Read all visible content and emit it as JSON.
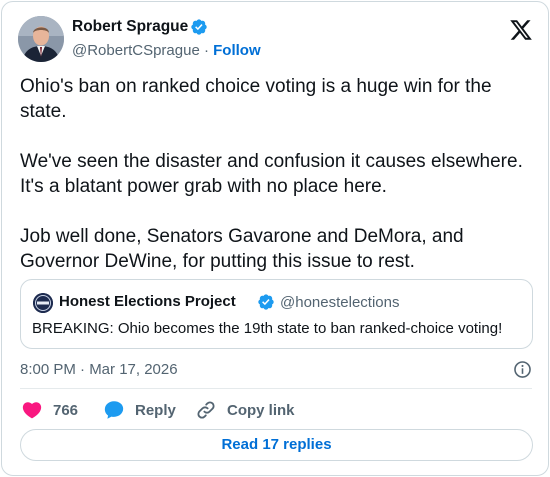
{
  "author": {
    "name": "Robert Sprague",
    "handle": "@RobertCSprague",
    "separator": " · ",
    "follow_label": "Follow"
  },
  "tweet": {
    "paragraphs": [
      "Ohio's ban on ranked choice voting is a huge win for the state.",
      "We've seen the disaster and confusion it causes elsewhere. It's a blatant power grab with no place here.",
      "Job well done, Senators Gavarone and DeMora, and Governor DeWine, for putting this issue to rest."
    ]
  },
  "quote": {
    "name": "Honest Elections Project",
    "handle": "@honestelections",
    "text": "BREAKING: Ohio becomes the 19th state to ban ranked-choice voting!"
  },
  "timestamp": "8:00 PM · Mar 17, 2026",
  "actions": {
    "like_count": "766",
    "reply_label": "Reply",
    "copy_label": "Copy link"
  },
  "read_replies_label": "Read 17 replies",
  "icons": {
    "verified": "verified-badge-icon",
    "x_logo": "x-logo-icon",
    "info": "info-icon",
    "heart": "heart-icon",
    "reply": "reply-bubble-icon",
    "link": "link-icon"
  },
  "colors": {
    "accent": "#006fd6",
    "verified": "#1d9bf0",
    "heart": "#f91880",
    "secondary_text": "#536471",
    "border": "#cfd9de"
  }
}
